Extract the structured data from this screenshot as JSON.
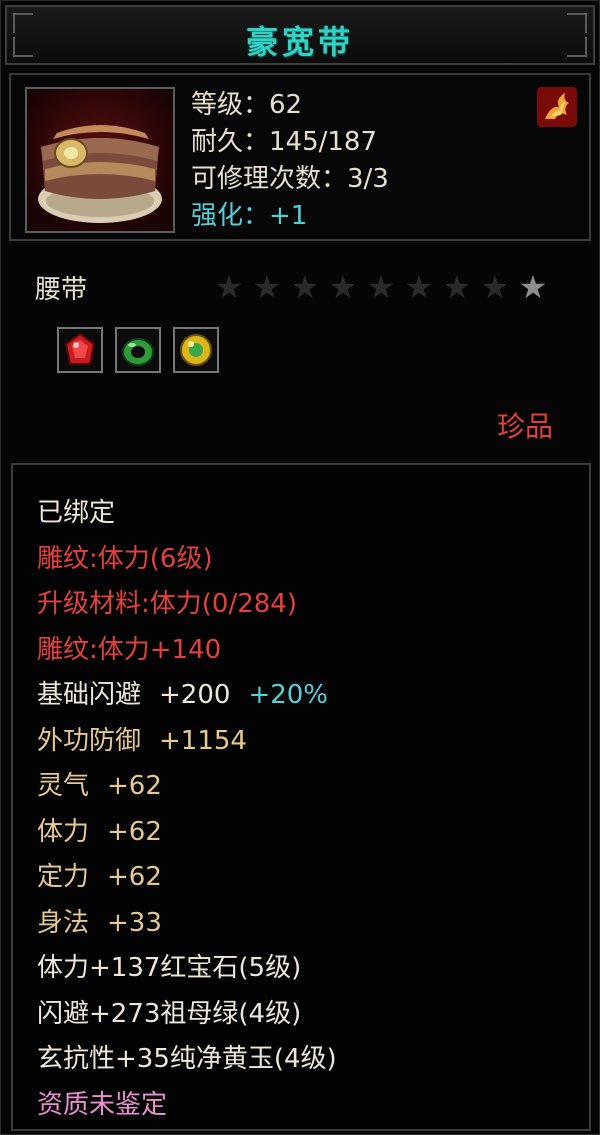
{
  "title": "豪宽带",
  "item": {
    "level": "等级：62",
    "durability": "耐久：145/187",
    "repair": "可修理次数：3/3",
    "enhance": "强化：+1",
    "type": "腰带",
    "stars": {
      "filled": 1,
      "total": 9
    },
    "rarity": "珍品"
  },
  "gems": [
    {
      "name": "ruby-gem-icon",
      "color": "#c81c22"
    },
    {
      "name": "emerald-ring-icon",
      "color": "#2e9a3a"
    },
    {
      "name": "yellow-jade-icon",
      "color": "#d8b61c"
    }
  ],
  "attributes": {
    "bound": "已绑定",
    "engrave1": "雕纹:体力(6级)",
    "upgrade": "升级材料:体力(0/284)",
    "engrave2": "雕纹:体力+140",
    "dodge_label": "基础闪避",
    "dodge_value": "+200",
    "dodge_bonus": "+20%",
    "defense_label": "外功防御",
    "defense_value": "+1154",
    "spirit_label": "灵气",
    "spirit_value": "+62",
    "stamina_label": "体力",
    "stamina_value": "+62",
    "focus_label": "定力",
    "focus_value": "+62",
    "agility_label": "身法",
    "agility_value": "+33",
    "gem1": "体力+137红宝石(5级)",
    "gem2": "闪避+273祖母绿(4级)",
    "gem3": "玄抗性+35纯净黄玉(4级)",
    "quality": "资质未鉴定"
  },
  "colors": {
    "title": "#2fd2c4",
    "red": "#e2413c",
    "gold": "#e6c98e",
    "cyan": "#52d1d8",
    "pink": "#e78fd0"
  }
}
